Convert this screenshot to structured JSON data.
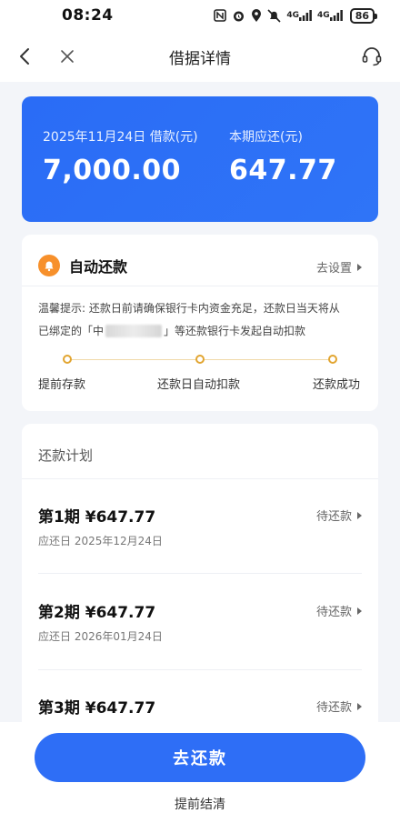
{
  "status_bar": {
    "time": "08:24",
    "net1": "4G",
    "net2": "4G",
    "battery": "86"
  },
  "nav": {
    "title": "借据详情"
  },
  "summary": {
    "loan_label": "2025年11月24日 借款(元)",
    "loan_amount": "7,000.00",
    "due_label": "本期应还(元)",
    "due_amount": "647.77"
  },
  "auto_repay": {
    "title": "自动还款",
    "settings_link": "去设置",
    "tip_line1": "温馨提示: 还款日前请确保银行卡内资金充足，还款日当天将从",
    "tip_line2_prefix": "已绑定的「中",
    "tip_line2_suffix": "」等还款银行卡发起自动扣款",
    "steps": [
      "提前存款",
      "还款日自动扣款",
      "还款成功"
    ]
  },
  "plan": {
    "title": "还款计划",
    "periods": [
      {
        "title": "第1期 ¥647.77",
        "status": "待还款",
        "date": "应还日 2025年12月24日"
      },
      {
        "title": "第2期 ¥647.77",
        "status": "待还款",
        "date": "应还日 2026年01月24日"
      },
      {
        "title": "第3期 ¥647.77",
        "status": "待还款"
      }
    ]
  },
  "actions": {
    "repay_button": "去还款",
    "early_settle": "提前结清"
  },
  "colors": {
    "primary": "#2e6ef6",
    "accent_orange": "#f7902b"
  },
  "icons": [
    "back-icon",
    "close-icon",
    "customer-service-icon",
    "bell-icon",
    "chevron-right-icon"
  ]
}
